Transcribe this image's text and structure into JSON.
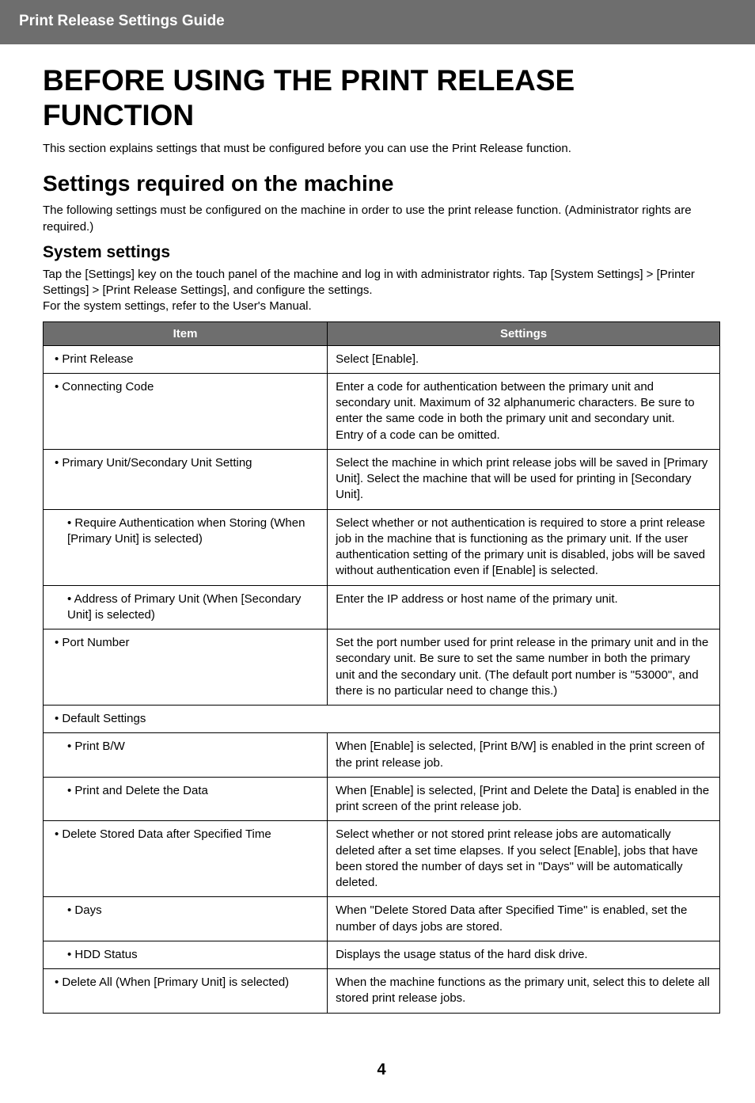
{
  "header": "Print Release Settings Guide",
  "h1": "BEFORE USING THE PRINT RELEASE FUNCTION",
  "intro": "This section explains settings that must be configured before you can use the Print Release function.",
  "h2": "Settings required on the machine",
  "h2_body": "The following settings must be configured on the machine in order to use the print release function. (Administrator rights are required.)",
  "h3": "System settings",
  "h3_body": "Tap the [Settings] key on the touch panel of the machine and log in with administrator rights. Tap [System Settings] > [Printer Settings] > [Print Release Settings], and configure the settings.\nFor the system settings, refer to the User's Manual.",
  "table_headers": {
    "item": "Item",
    "settings": "Settings"
  },
  "rows": [
    {
      "indent": 0,
      "item": "Print Release",
      "settings": "Select [Enable]."
    },
    {
      "indent": 0,
      "item": "Connecting Code",
      "settings": "Enter a code for authentication between the primary unit and secondary unit. Maximum of 32 alphanumeric characters. Be sure to enter the same code in both the primary unit and secondary unit.\nEntry of a code can be omitted."
    },
    {
      "indent": 0,
      "item": "Primary Unit/Secondary Unit Setting",
      "settings": "Select the machine in which print release jobs will be saved in [Primary Unit]. Select the machine that will be used for printing in [Secondary Unit]."
    },
    {
      "indent": 1,
      "item": "Require Authentication when Storing (When [Primary Unit] is selected)",
      "settings": "Select whether or not authentication is required to store a print release job in the machine that is functioning as the primary unit. If the user authentication setting of the primary unit is disabled, jobs will be saved without authentication even if [Enable] is selected."
    },
    {
      "indent": 1,
      "item": "Address of Primary Unit (When [Secondary Unit] is selected)",
      "settings": "Enter the IP address or host name of the primary unit."
    },
    {
      "indent": 0,
      "item": "Port Number",
      "settings": "Set the port number used for print release in the primary unit and in the secondary unit. Be sure to set the same number in both the primary unit and the secondary unit. (The default port number is \"53000\", and there is no particular need to change this.)"
    },
    {
      "indent": 0,
      "item": "Default Settings",
      "settings": "",
      "span": true
    },
    {
      "indent": 1,
      "item": "Print B/W",
      "settings": "When [Enable] is selected, [Print B/W] is enabled in the print screen of the print release job."
    },
    {
      "indent": 1,
      "item": "Print and Delete the Data",
      "settings": "When [Enable] is selected, [Print and Delete the Data] is enabled in the print screen of the print release job."
    },
    {
      "indent": 0,
      "item": "Delete Stored Data after Specified Time",
      "settings": "Select whether or not stored print release jobs are automatically deleted after a set time elapses. If you select [Enable], jobs that have been stored the number of days set in \"Days\" will be automatically deleted."
    },
    {
      "indent": 1,
      "item": "Days",
      "settings": "When \"Delete Stored Data after Specified Time\" is enabled, set the number of days jobs are stored."
    },
    {
      "indent": 1,
      "item": "HDD Status",
      "settings": "Displays the usage status of the hard disk drive."
    },
    {
      "indent": 0,
      "item": "Delete All (When [Primary Unit] is selected)",
      "settings": "When the machine functions as the primary unit, select this to delete all stored print release jobs."
    }
  ],
  "page_number": "4"
}
